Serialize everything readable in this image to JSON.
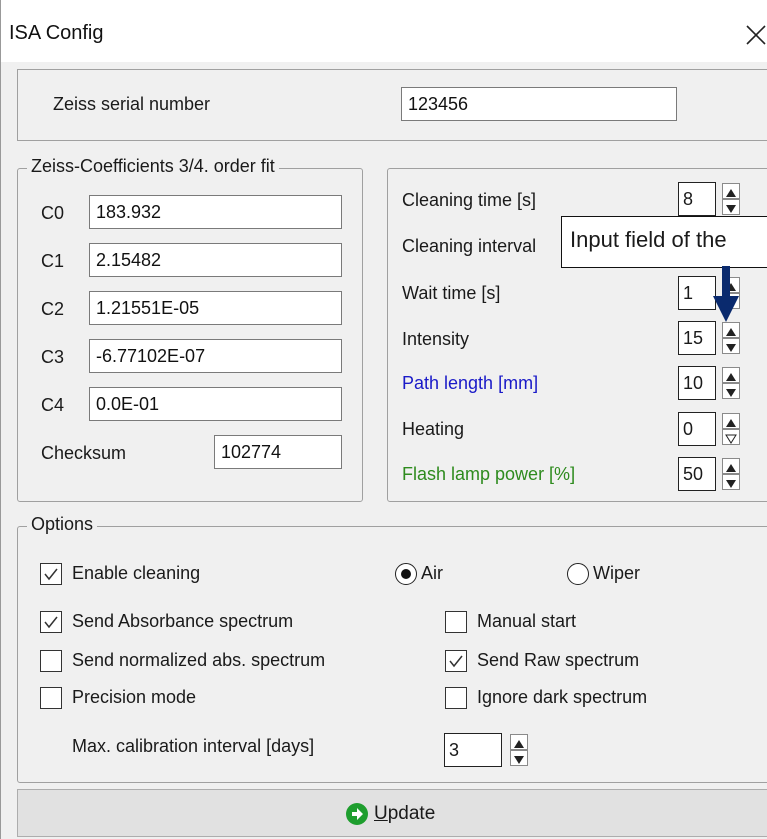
{
  "window": {
    "title": "ISA Config"
  },
  "serial": {
    "label": "Zeiss serial number",
    "value": "123456"
  },
  "coefficients": {
    "legend": "Zeiss-Coefficients 3/4. order fit",
    "items": [
      {
        "label": "C0",
        "value": "183.932"
      },
      {
        "label": "C1",
        "value": "2.15482"
      },
      {
        "label": "C2",
        "value": "1.21551E-05"
      },
      {
        "label": "C3",
        "value": "-6.77102E-07"
      },
      {
        "label": "C4",
        "value": "0.0E-01"
      }
    ],
    "checksum_label": "Checksum",
    "checksum_value": "102774"
  },
  "settings": {
    "items": [
      {
        "label": "Cleaning time [s]",
        "value": "8",
        "color": "#1a1a1a"
      },
      {
        "label": "Cleaning interval",
        "value": "",
        "color": "#1a1a1a"
      },
      {
        "label": "Wait time [s]",
        "value": "1",
        "color": "#1a1a1a"
      },
      {
        "label": "Intensity",
        "value": "15",
        "color": "#1a1a1a"
      },
      {
        "label": "Path length [mm]",
        "value": "10",
        "color": "#1a1ac8"
      },
      {
        "label": "Heating",
        "value": "0",
        "color": "#1a1a1a"
      },
      {
        "label": "Flash lamp power [%]",
        "value": "50",
        "color": "#2e8b1e"
      }
    ]
  },
  "tooltip": {
    "text": "Input field of the"
  },
  "options": {
    "legend": "Options",
    "enable_cleaning": {
      "label": "Enable cleaning",
      "checked": true
    },
    "radio_air": {
      "label": "Air",
      "selected": true
    },
    "radio_wiper": {
      "label": "Wiper",
      "selected": false
    },
    "send_absorbance": {
      "label": "Send Absorbance spectrum",
      "checked": true
    },
    "manual_start": {
      "label": "Manual start",
      "checked": false
    },
    "send_normalized": {
      "label": "Send normalized abs. spectrum",
      "checked": false
    },
    "send_raw": {
      "label": "Send Raw spectrum",
      "checked": true
    },
    "precision_mode": {
      "label": "Precision mode",
      "checked": false
    },
    "ignore_dark": {
      "label": "Ignore dark spectrum",
      "checked": false
    },
    "max_calibration_label": "Max. calibration interval [days]",
    "max_calibration_value": "3"
  },
  "update": {
    "label_prefix": "U",
    "label_rest": "pdate"
  },
  "icons": {
    "close": "close-icon",
    "update": "arrow-right-circle-icon",
    "pointer": "arrow-down-icon"
  }
}
